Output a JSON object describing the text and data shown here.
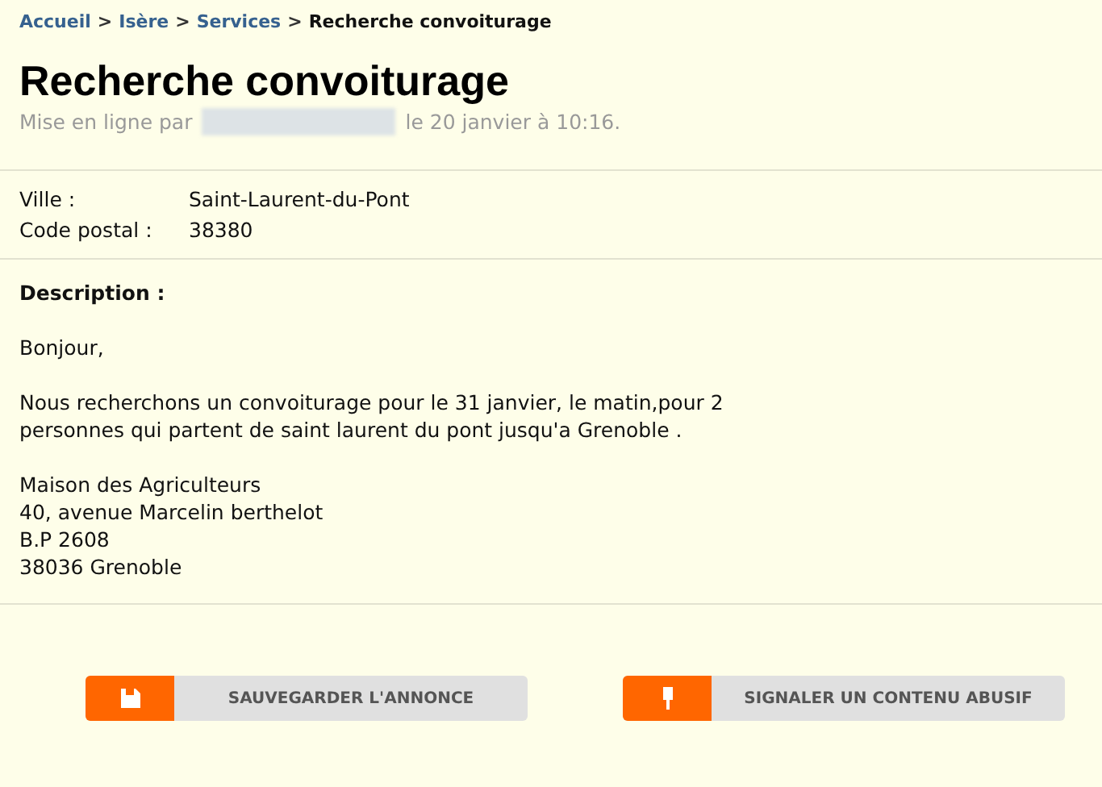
{
  "breadcrumb": [
    {
      "label": "Accueil",
      "kind": "link"
    },
    {
      "label": "Isère",
      "kind": "link"
    },
    {
      "label": "Services",
      "kind": "link"
    },
    {
      "label": "Recherche convoiturage",
      "kind": "current"
    }
  ],
  "breadcrumb_separator": ">",
  "title": "Recherche convoiturage",
  "posted": {
    "prefix": "Mise en ligne par",
    "suffix": "le 20 janvier à 10:16."
  },
  "details": [
    {
      "label": "Ville :",
      "value": "Saint-Laurent-du-Pont"
    },
    {
      "label": "Code postal :",
      "value": "38380"
    }
  ],
  "description": {
    "heading": "Description :",
    "paragraphs": [
      [
        "Bonjour,"
      ],
      [
        "Nous recherchons un convoiturage pour le 31 janvier, le matin,pour 2",
        "personnes qui partent de saint laurent du pont jusqu'a Grenoble ."
      ],
      [
        "Maison des Agriculteurs",
        "40, avenue Marcelin berthelot",
        "B.P 2608",
        "38036 Grenoble"
      ]
    ]
  },
  "buttons": [
    {
      "label": "SAUVEGARDER L'ANNONCE",
      "kind": "save"
    },
    {
      "label": "SIGNALER UN CONTENU ABUSIF",
      "kind": "report"
    }
  ]
}
